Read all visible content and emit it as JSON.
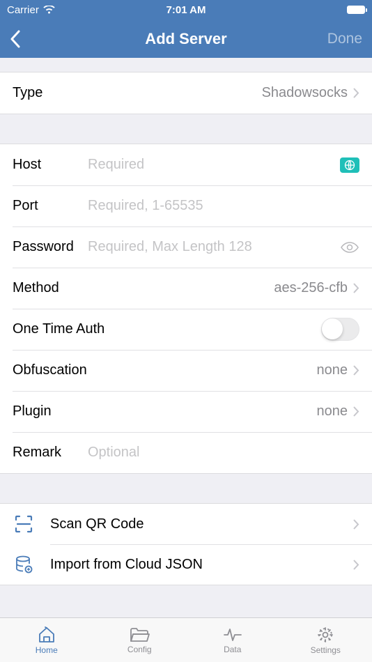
{
  "status": {
    "carrier": "Carrier",
    "time": "7:01 AM"
  },
  "nav": {
    "title": "Add Server",
    "done": "Done"
  },
  "type": {
    "label": "Type",
    "value": "Shadowsocks"
  },
  "host": {
    "label": "Host",
    "placeholder": "Required",
    "value": ""
  },
  "port": {
    "label": "Port",
    "placeholder": "Required, 1-65535",
    "value": ""
  },
  "password": {
    "label": "Password",
    "placeholder": "Required, Max Length 128",
    "value": ""
  },
  "method": {
    "label": "Method",
    "value": "aes-256-cfb"
  },
  "ota": {
    "label": "One Time Auth"
  },
  "obfuscation": {
    "label": "Obfuscation",
    "value": "none"
  },
  "plugin": {
    "label": "Plugin",
    "value": "none"
  },
  "remark": {
    "label": "Remark",
    "placeholder": "Optional",
    "value": ""
  },
  "actions": {
    "scan": "Scan QR Code",
    "import": "Import from Cloud JSON"
  },
  "tabs": {
    "home": "Home",
    "config": "Config",
    "data": "Data",
    "settings": "Settings"
  }
}
